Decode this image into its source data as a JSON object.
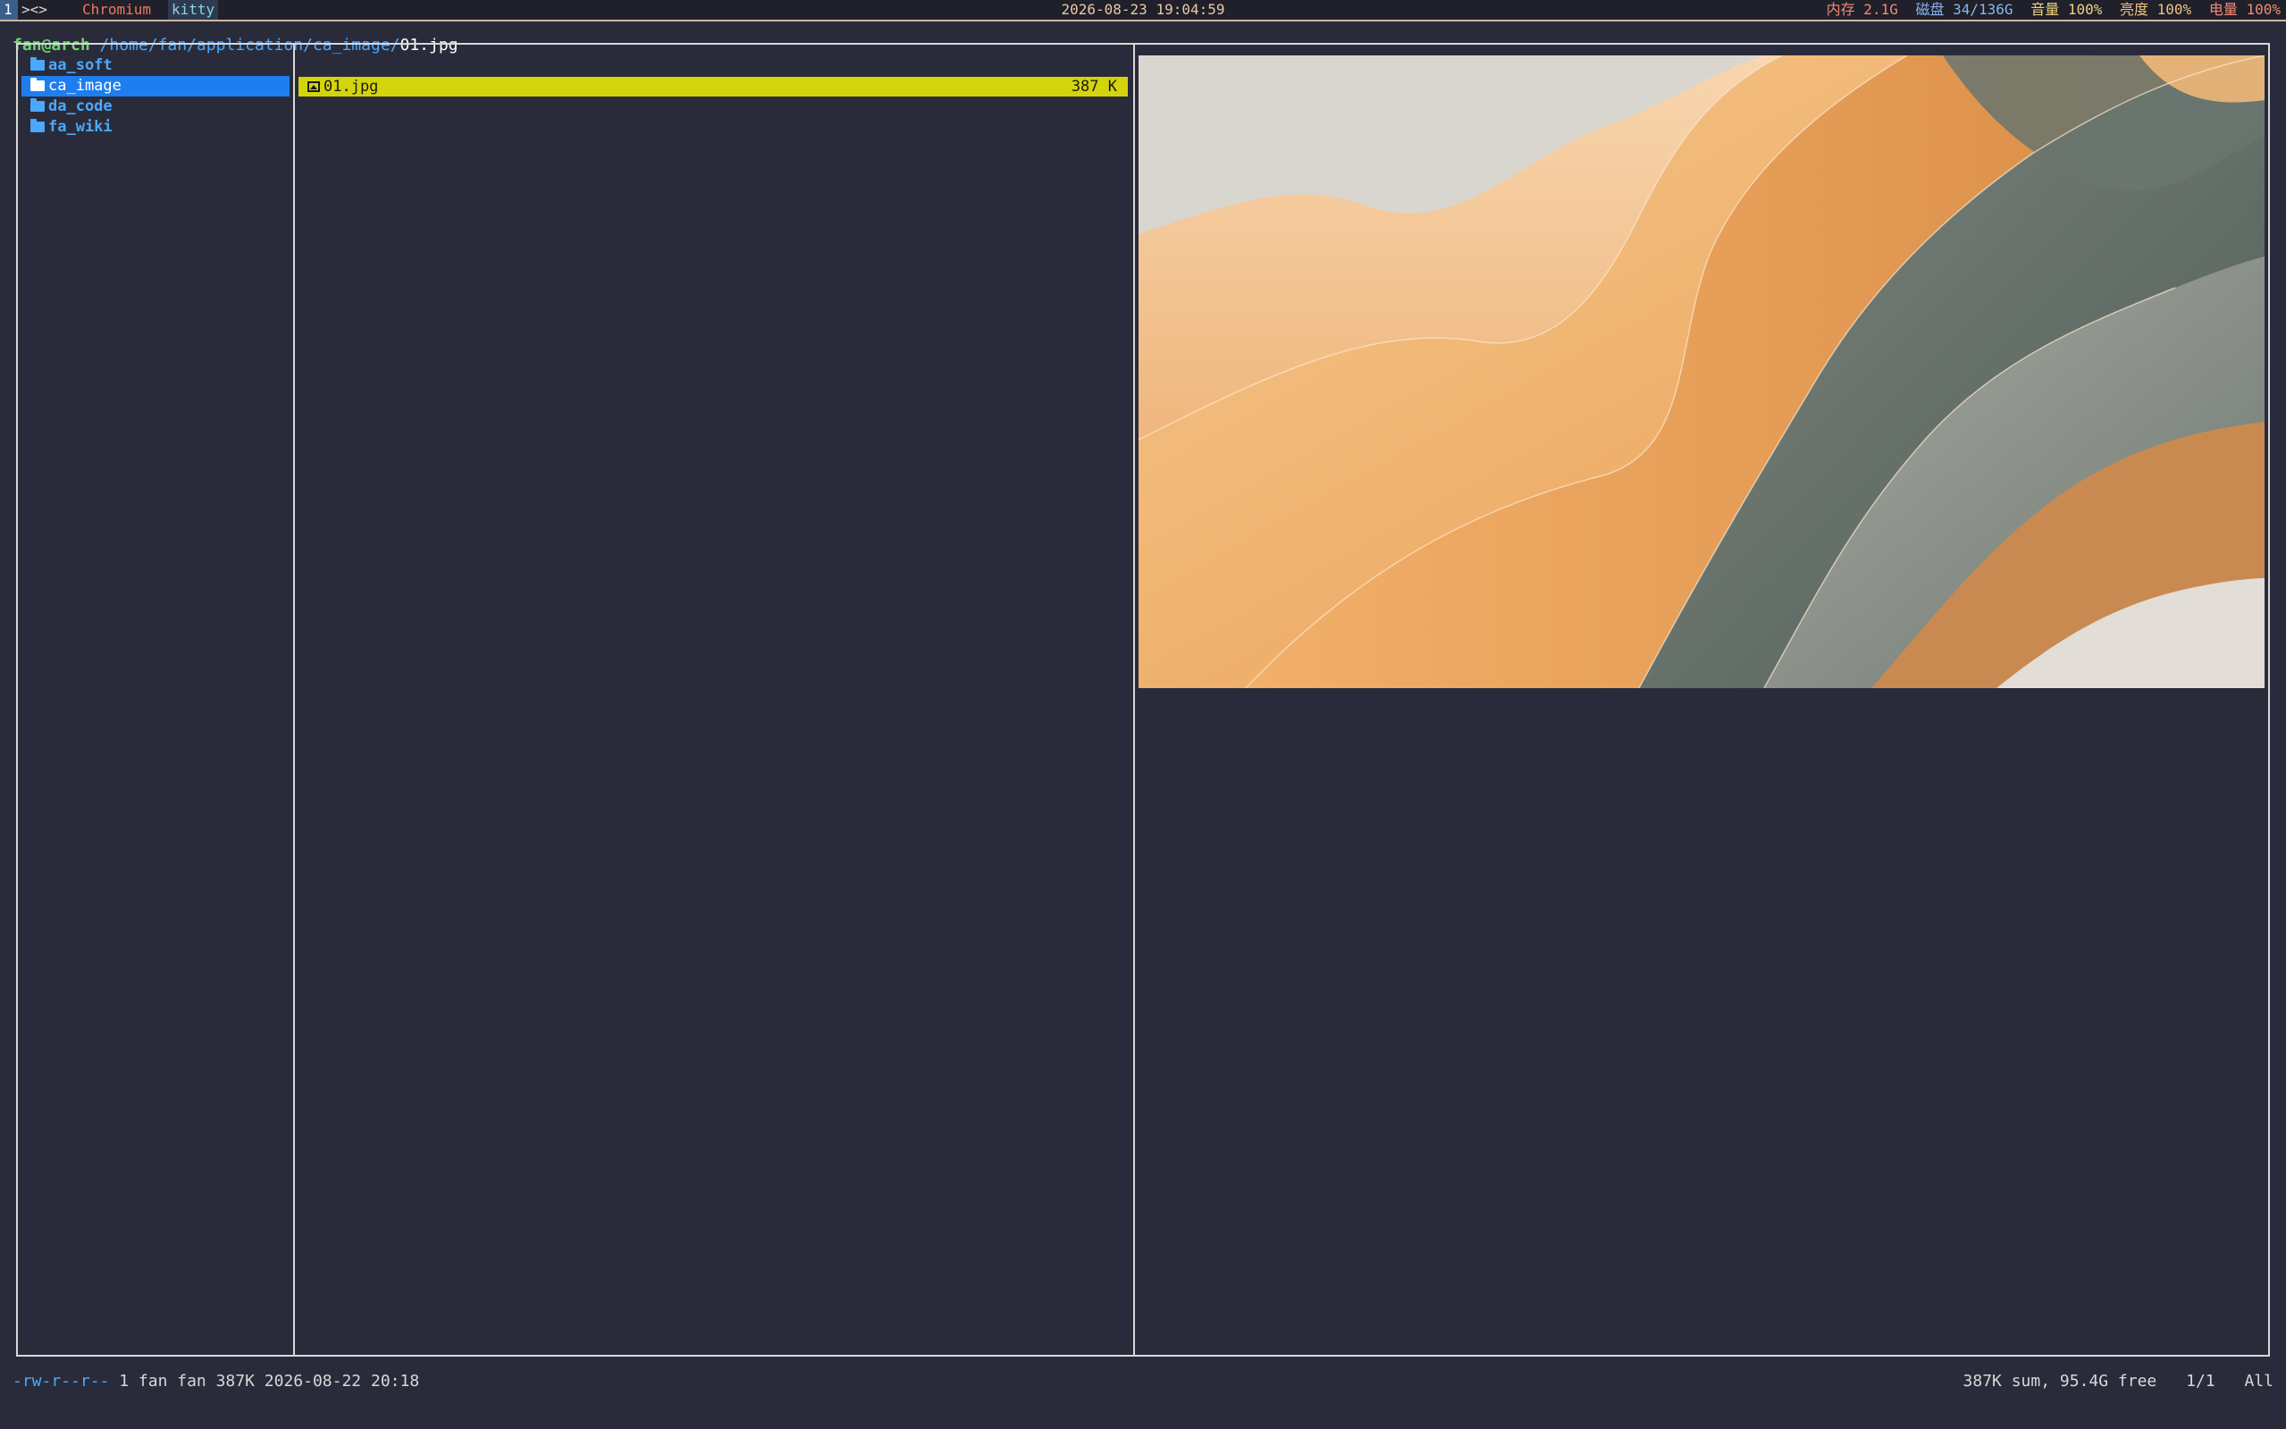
{
  "topbar": {
    "workspace": "1",
    "layout": "><>",
    "apps": [
      "Chromium",
      "kitty"
    ],
    "clock": "2026-08-23 19:04:59",
    "memory": "内存 2.1G",
    "disk": "磁盘 34/136G",
    "volume": "音量 100%",
    "brightness": "亮度 100%",
    "battery": "电量 100%"
  },
  "path": {
    "user": "fan@arch",
    "dir": "/home/fan/application/ca_image/",
    "file": "01.jpg"
  },
  "parent_dirs": [
    {
      "name": "aa_soft",
      "selected": false
    },
    {
      "name": "ca_image",
      "selected": true
    },
    {
      "name": "da_code",
      "selected": false
    },
    {
      "name": "fa_wiki",
      "selected": false
    }
  ],
  "files": [
    {
      "name": "01.jpg",
      "size": "387 K",
      "selected": true
    }
  ],
  "statusline": {
    "permissions": "-rw-r--r--",
    "info": "1 fan fan 387K 2026-08-22 20:18",
    "disk_summary": "387K sum, 95.4G free",
    "position": "1/1",
    "scroll": "All"
  },
  "colors": {
    "accent_blue": "#1e7ef0",
    "dir_blue": "#4aa8ff",
    "selection_yellow": "#d4d40c",
    "terminal_bg": "#2a2b3a"
  },
  "icons": {
    "folder": "folder-icon",
    "image": "image-file-icon"
  }
}
